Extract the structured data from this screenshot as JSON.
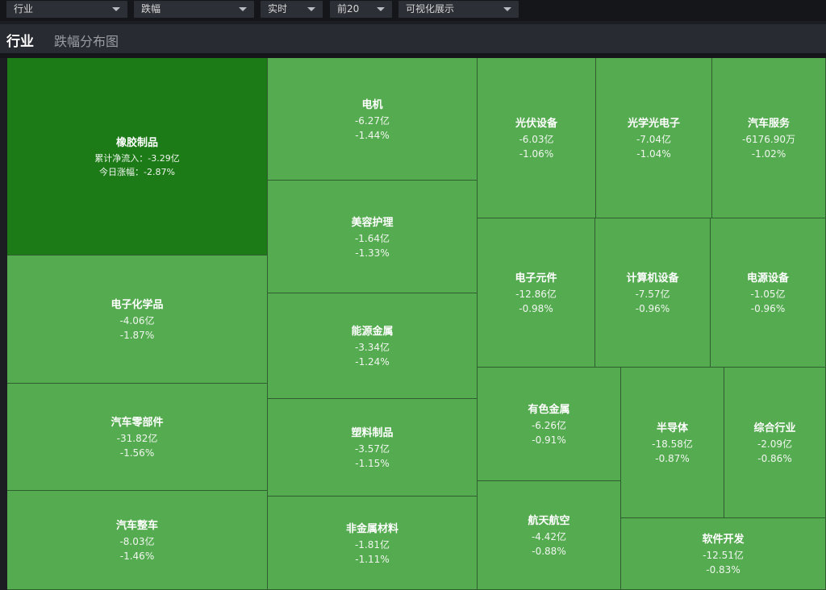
{
  "filters": [
    {
      "label": "行业"
    },
    {
      "label": "跌幅"
    },
    {
      "label": "实时"
    },
    {
      "label": "前20"
    },
    {
      "label": "可视化展示"
    }
  ],
  "header": {
    "title": "行业",
    "subtitle": "跌幅分布图"
  },
  "colors": {
    "cell": "#55ab50",
    "highlight": "#1c7a17"
  },
  "cells": [
    {
      "name": "橡胶制品",
      "flow_label": "累计净流入：",
      "flow": "-3.29亿",
      "chg_label": "今日涨幅：",
      "chg": "-2.87%"
    },
    {
      "name": "电子化学品",
      "flow": "-4.06亿",
      "chg": "-1.87%"
    },
    {
      "name": "汽车零部件",
      "flow": "-31.82亿",
      "chg": "-1.56%"
    },
    {
      "name": "汽车整车",
      "flow": "-8.03亿",
      "chg": "-1.46%"
    },
    {
      "name": "电机",
      "flow": "-6.27亿",
      "chg": "-1.44%"
    },
    {
      "name": "美容护理",
      "flow": "-1.64亿",
      "chg": "-1.33%"
    },
    {
      "name": "能源金属",
      "flow": "-3.34亿",
      "chg": "-1.24%"
    },
    {
      "name": "塑料制品",
      "flow": "-3.57亿",
      "chg": "-1.15%"
    },
    {
      "name": "非金属材料",
      "flow": "-1.81亿",
      "chg": "-1.11%"
    },
    {
      "name": "光伏设备",
      "flow": "-6.03亿",
      "chg": "-1.06%"
    },
    {
      "name": "光学光电子",
      "flow": "-7.04亿",
      "chg": "-1.04%"
    },
    {
      "name": "汽车服务",
      "flow": "-6176.90万",
      "chg": "-1.02%"
    },
    {
      "name": "电子元件",
      "flow": "-12.86亿",
      "chg": "-0.98%"
    },
    {
      "name": "计算机设备",
      "flow": "-7.57亿",
      "chg": "-0.96%"
    },
    {
      "name": "电源设备",
      "flow": "-1.05亿",
      "chg": "-0.96%"
    },
    {
      "name": "有色金属",
      "flow": "-6.26亿",
      "chg": "-0.91%"
    },
    {
      "name": "航天航空",
      "flow": "-4.42亿",
      "chg": "-0.88%"
    },
    {
      "name": "半导体",
      "flow": "-18.58亿",
      "chg": "-0.87%"
    },
    {
      "name": "综合行业",
      "flow": "-2.09亿",
      "chg": "-0.86%"
    },
    {
      "name": "软件开发",
      "flow": "-12.51亿",
      "chg": "-0.83%"
    }
  ]
}
